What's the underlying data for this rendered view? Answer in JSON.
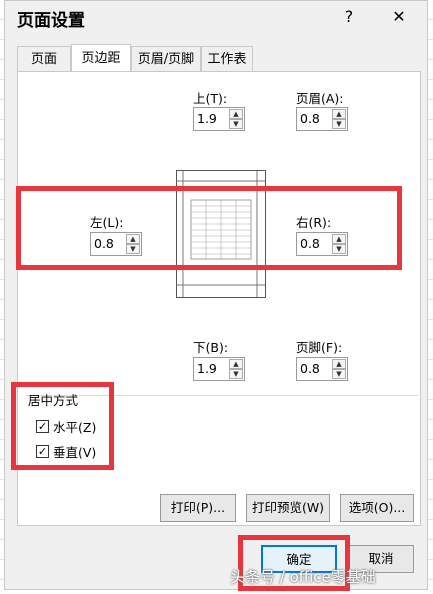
{
  "dialog": {
    "title": "页面设置",
    "help": "?",
    "close": "✕"
  },
  "tabs": [
    {
      "label": "页面"
    },
    {
      "label": "页边距"
    },
    {
      "label": "页眉/页脚"
    },
    {
      "label": "工作表"
    }
  ],
  "margins": {
    "top": {
      "label": "上(T):",
      "value": "1.9"
    },
    "header": {
      "label": "页眉(A):",
      "value": "0.8"
    },
    "left": {
      "label": "左(L):",
      "value": "0.8"
    },
    "right": {
      "label": "右(R):",
      "value": "0.8"
    },
    "bottom": {
      "label": "下(B):",
      "value": "1.9"
    },
    "footer": {
      "label": "页脚(F):",
      "value": "0.8"
    }
  },
  "centering": {
    "title": "居中方式",
    "horizontal": {
      "label": "水平(Z)",
      "checked": true
    },
    "vertical": {
      "label": "垂直(V)",
      "checked": true
    }
  },
  "buttons": {
    "print": "打印(P)...",
    "preview": "打印预览(W)",
    "options": "选项(O)...",
    "ok": "确定",
    "cancel": "取消"
  },
  "watermark": "头条号 / office零基础",
  "colors": {
    "highlight": "#e8363f",
    "ok_border": "#0078d7"
  }
}
